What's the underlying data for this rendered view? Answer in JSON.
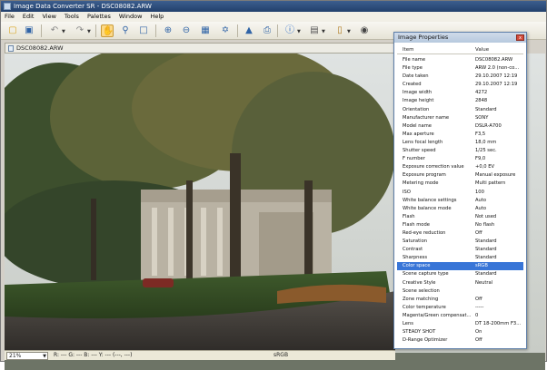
{
  "window": {
    "title": "Image Data Converter SR - DSC08082.ARW"
  },
  "menu": {
    "items": [
      "File",
      "Edit",
      "View",
      "Tools",
      "Palettes",
      "Window",
      "Help"
    ]
  },
  "toolbar": {
    "buttons": [
      "open-icon",
      "save-icon",
      "undo-icon",
      "redo-icon",
      "hand-icon",
      "zoom-icon",
      "crop-icon",
      "zoom-in-icon",
      "zoom-out-icon",
      "fit-icon",
      "actual-size-icon",
      "export-icon",
      "print-icon",
      "info-icon",
      "layout-icon",
      "palette-icon",
      "camera-icon"
    ]
  },
  "document": {
    "tab_title": "DSC08082.ARW"
  },
  "status": {
    "zoom": "21%",
    "readout": "R: ---  G: ---  B: ---  Y: ---   (---, ---)",
    "profile": "sRGB"
  },
  "palette": {
    "title": "Image Properties",
    "close_glyph": "x",
    "header_item": "Item",
    "header_value": "Value",
    "rows": [
      {
        "name": "File name",
        "value": "DSC08082.ARW"
      },
      {
        "name": "File type",
        "value": "ARW 2.0 (non-co..."
      },
      {
        "name": "Date taken",
        "value": "29.10.2007 12:19"
      },
      {
        "name": "Created",
        "value": "29.10.2007 12:19"
      },
      {
        "name": "Image width",
        "value": "4272"
      },
      {
        "name": "Image height",
        "value": "2848"
      },
      {
        "name": "Orientation",
        "value": "Standard"
      },
      {
        "name": "Manufacturer name",
        "value": "SONY"
      },
      {
        "name": "Model name",
        "value": "DSLR-A700"
      },
      {
        "name": "Max aperture",
        "value": "F3,5"
      },
      {
        "name": "Lens focal length",
        "value": "18,0 mm"
      },
      {
        "name": "Shutter speed",
        "value": "1/25 sec."
      },
      {
        "name": "F number",
        "value": "F9,0"
      },
      {
        "name": "Exposure correction value",
        "value": "+0,0 EV"
      },
      {
        "name": "Exposure program",
        "value": "Manual exposure"
      },
      {
        "name": "Metering mode",
        "value": "Multi pattern"
      },
      {
        "name": "ISO",
        "value": "100"
      },
      {
        "name": "White balance settings",
        "value": "Auto"
      },
      {
        "name": "White balance mode",
        "value": "Auto"
      },
      {
        "name": "Flash",
        "value": "Not used"
      },
      {
        "name": "Flash mode",
        "value": "No flash"
      },
      {
        "name": "Red-eye reduction",
        "value": "Off"
      },
      {
        "name": "Saturation",
        "value": "Standard"
      },
      {
        "name": "Contrast",
        "value": "Standard"
      },
      {
        "name": "Sharpness",
        "value": "Standard"
      },
      {
        "name": "Color space",
        "value": "sRGB",
        "selected": true
      },
      {
        "name": "Scene capture type",
        "value": "Standard"
      },
      {
        "name": "Creative Style",
        "value": "Neutral"
      },
      {
        "name": "Scene selection",
        "value": ""
      },
      {
        "name": "Zone matching",
        "value": "Off"
      },
      {
        "name": "Color temperature",
        "value": "-----"
      },
      {
        "name": "Magenta/Green compensat...",
        "value": "0"
      },
      {
        "name": "Lens",
        "value": "DT 18-200mm F3..."
      },
      {
        "name": "STEADY SHOT",
        "value": "On"
      },
      {
        "name": "D-Range Optimizer",
        "value": "Off"
      }
    ]
  }
}
